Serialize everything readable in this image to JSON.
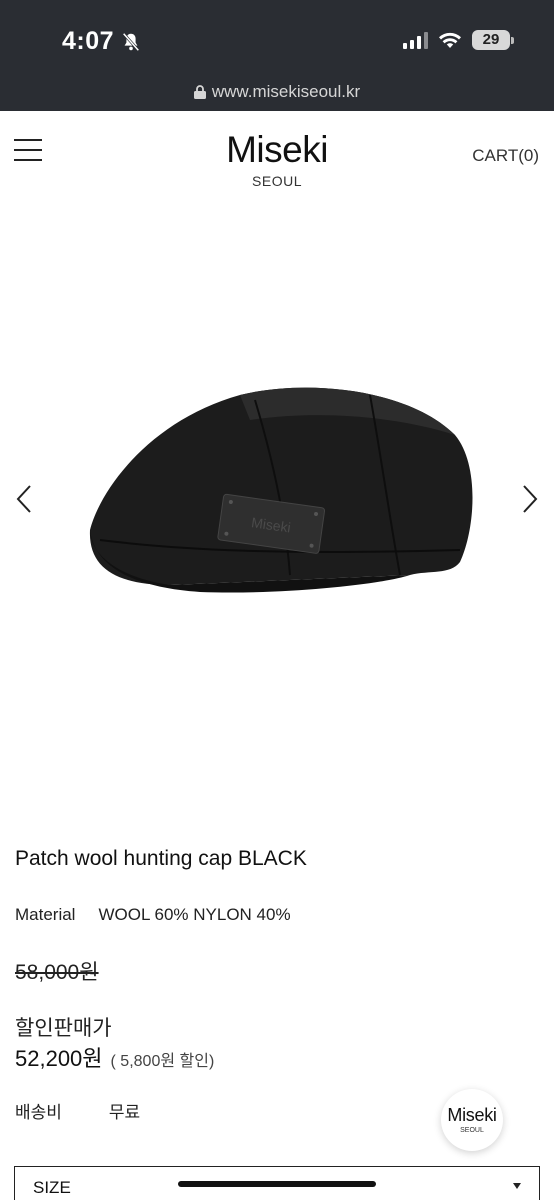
{
  "status_bar": {
    "time": "4:07",
    "battery": "29",
    "icons": [
      "bell-slash-icon",
      "signal-icon",
      "wifi-icon",
      "battery-icon"
    ]
  },
  "browser": {
    "url": "www.misekiseoul.kr",
    "lock_icon": "lock-icon"
  },
  "header": {
    "brand": "Miseki",
    "brand_sub": "SEOUL",
    "cart": "CART(0)",
    "menu_icon": "hamburger-menu-icon"
  },
  "gallery": {
    "prev_icon": "chevron-left-icon",
    "next_icon": "chevron-right-icon",
    "patch_text": "Miseki"
  },
  "product": {
    "title": "Patch wool hunting cap BLACK",
    "material_label": "Material",
    "material_value": "WOOL 60% NYLON 40%",
    "original_price": "58,000원",
    "sale_label": "할인판매가",
    "sale_price": "52,200원",
    "discount": "( 5,800원 할인)",
    "shipping_label": "배송비",
    "shipping_value": "무료"
  },
  "badge": {
    "name": "Miseki",
    "sub": "SEOUL"
  },
  "size_select": {
    "label": "SIZE"
  },
  "colors": {
    "status_bg": "#2a2d33",
    "text": "#111111"
  }
}
